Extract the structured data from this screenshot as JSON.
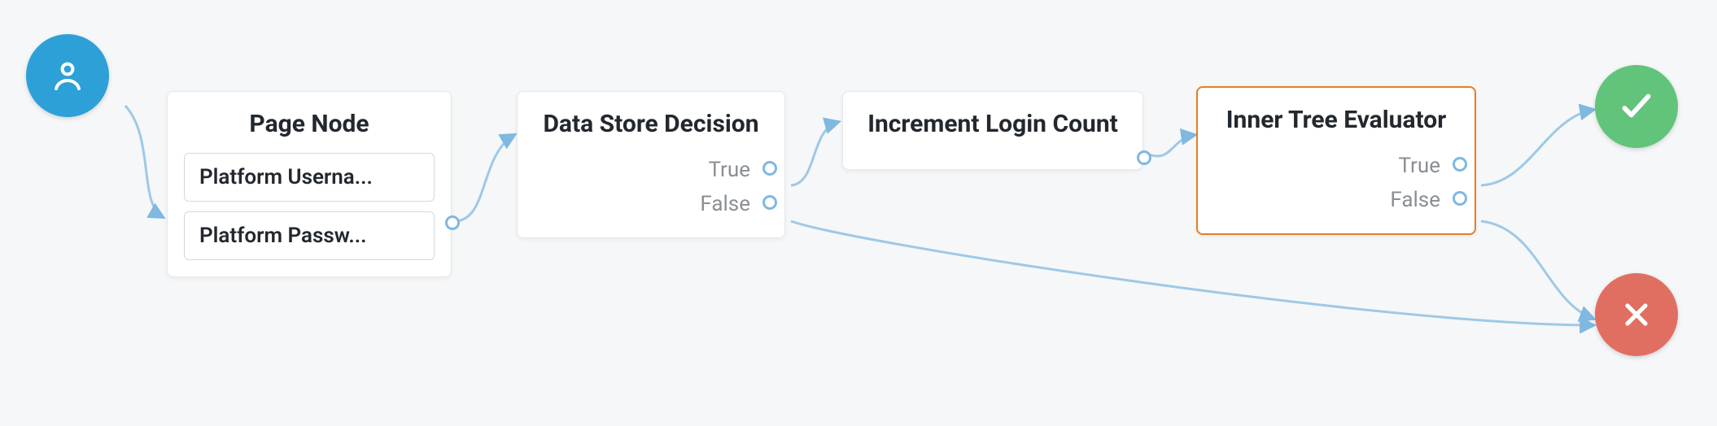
{
  "chart_data": {
    "type": "flow-tree",
    "nodes": [
      {
        "id": "start",
        "type": "start",
        "label": "User"
      },
      {
        "id": "page",
        "type": "page",
        "title": "Page Node",
        "items": [
          "Platform Userna...",
          "Platform Passw..."
        ]
      },
      {
        "id": "decision",
        "type": "node",
        "title": "Data Store Decision",
        "outcomes": [
          "True",
          "False"
        ]
      },
      {
        "id": "increment",
        "type": "node",
        "title": "Increment Login Count",
        "outcomes": []
      },
      {
        "id": "inner",
        "type": "node",
        "title": "Inner Tree Evaluator",
        "outcomes": [
          "True",
          "False"
        ],
        "selected": true
      },
      {
        "id": "success",
        "type": "terminal",
        "label": "Success"
      },
      {
        "id": "failure",
        "type": "terminal",
        "label": "Failure"
      }
    ],
    "edges": [
      {
        "from": "start",
        "to": "page"
      },
      {
        "from": "page",
        "to": "decision"
      },
      {
        "from": "decision",
        "outcome": "True",
        "to": "increment"
      },
      {
        "from": "decision",
        "outcome": "False",
        "to": "failure"
      },
      {
        "from": "increment",
        "to": "inner"
      },
      {
        "from": "inner",
        "outcome": "True",
        "to": "success"
      },
      {
        "from": "inner",
        "outcome": "False",
        "to": "failure"
      }
    ]
  },
  "nodes": {
    "page": {
      "title": "Page Node",
      "item1": "Platform Userna...",
      "item2": "Platform Passw..."
    },
    "decision": {
      "title": "Data Store Decision",
      "true": "True",
      "false": "False"
    },
    "increment": {
      "title": "Increment Login Count"
    },
    "inner": {
      "title": "Inner Tree Evaluator",
      "true": "True",
      "false": "False"
    }
  },
  "colors": {
    "start": "#2da0d8",
    "success": "#62c37a",
    "failure": "#e16f61",
    "selected": "#e67e22",
    "edge": "#9ec9e6"
  }
}
